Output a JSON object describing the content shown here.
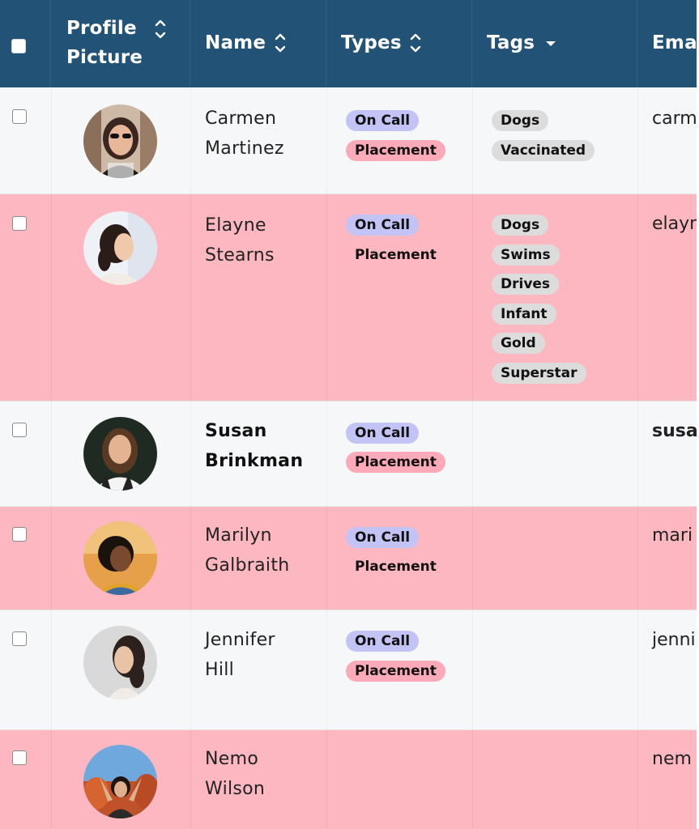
{
  "header": {
    "profile_line1": "Profile",
    "profile_line2": "Picture",
    "name": "Name",
    "types": "Types",
    "tags": "Tags",
    "email": "Ema"
  },
  "rows": [
    {
      "first": "Carmen",
      "last": "Martinez",
      "oncall": "On Call",
      "placement": "Placement",
      "tags": [
        "Dogs",
        "Vaccinated"
      ],
      "email": "carm"
    },
    {
      "first": "Elayne",
      "last": "Stearns",
      "oncall": "On Call",
      "placement": "Placement",
      "tags": [
        "Dogs",
        "Swims",
        "Drives",
        "Infant",
        "Gold",
        "Superstar"
      ],
      "email": "elayn"
    },
    {
      "first": "Susan",
      "last": "Brinkman",
      "oncall": "On Call",
      "placement": "Placement",
      "tags": [],
      "email": "susa"
    },
    {
      "first": "Marilyn",
      "last": "Galbraith",
      "oncall": "On Call",
      "placement": "Placement",
      "tags": [],
      "email": "mari"
    },
    {
      "first": "Jennifer",
      "last": "Hill",
      "oncall": "On Call",
      "placement": "Placement",
      "tags": [],
      "email": "jenni"
    },
    {
      "first": "Nemo",
      "last": "Wilson",
      "oncall": "",
      "placement": "",
      "tags": [],
      "email": "nem"
    }
  ],
  "colors": {
    "header_bg": "#235277",
    "row_light": "#f6f7f8",
    "row_pink": "#fdb7c0",
    "oncall_badge": "#c3c3f6",
    "placement_badge": "#fcaab9",
    "tag_badge": "#dcdcdc"
  }
}
